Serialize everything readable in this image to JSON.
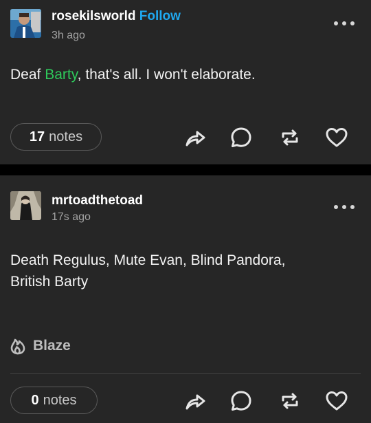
{
  "posts": [
    {
      "username": "rosekilsworld",
      "follow_label": "Follow",
      "time": "3h ago",
      "text_before": "Deaf ",
      "text_highlight": "Barty",
      "text_after": ", that's all. I won't elaborate.",
      "notes_count": "17",
      "notes_label": "notes"
    },
    {
      "username": "mrtoadthetoad",
      "time": "17s ago",
      "text_line1": "Death Regulus, Mute Evan, Blind Pandora,",
      "text_line2": "British Barty",
      "blaze_label": "Blaze",
      "notes_count": "0",
      "notes_label": "notes"
    }
  ],
  "icons": [
    "share-icon",
    "reply-icon",
    "reblog-icon",
    "like-icon",
    "more-options-icon",
    "blaze-flame-icon"
  ],
  "colors": {
    "background": "#262626",
    "follow": "#1fa8f0",
    "highlight": "#2ec95b",
    "text": "#ffffff",
    "muted": "#a3a3a3"
  }
}
